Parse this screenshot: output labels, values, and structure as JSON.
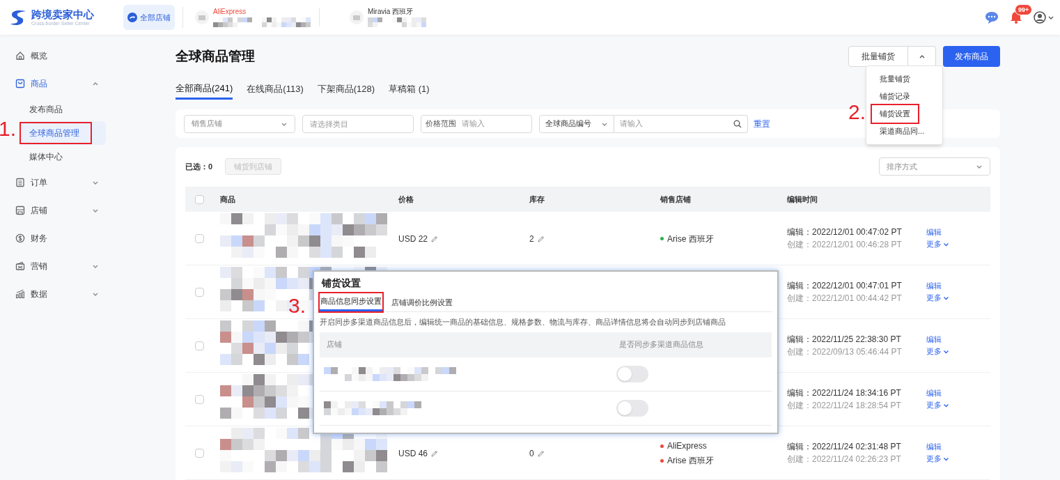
{
  "header": {
    "logo_title": "跨境卖家中心",
    "logo_subtitle": "Cross-border Seller Center",
    "store_tabs": [
      {
        "label": "全部店铺",
        "selected": true
      },
      {
        "label": "AliExpress",
        "selected": false,
        "color": "#f0483c"
      },
      {
        "label": "Miravia 西班牙",
        "selected": false
      }
    ],
    "notification_badge": "99+"
  },
  "sidebar": {
    "items": [
      {
        "label": "概览",
        "selected": false
      },
      {
        "label": "商品",
        "selected": true,
        "expanded": true,
        "children": [
          {
            "label": "发布商品",
            "selected": false,
            "highlighted": false
          },
          {
            "label": "全球商品管理",
            "selected": true,
            "highlighted": true
          },
          {
            "label": "媒体中心",
            "selected": false,
            "highlighted": false
          }
        ]
      },
      {
        "label": "订单",
        "selected": false,
        "expanded": false
      },
      {
        "label": "店铺",
        "selected": false,
        "expanded": false
      },
      {
        "label": "财务",
        "selected": false
      },
      {
        "label": "营销",
        "selected": false,
        "expanded": false
      },
      {
        "label": "数据",
        "selected": false,
        "expanded": false
      }
    ]
  },
  "page_title": "全球商品管理",
  "actions": {
    "bulk_button": "批量铺货",
    "bulk_menu_expanded": true,
    "publish_button": "发布商品",
    "bulk_menu": [
      {
        "label": "批量铺货",
        "highlighted": false
      },
      {
        "label": "铺货记录",
        "highlighted": false
      },
      {
        "label": "铺货设置",
        "highlighted": true
      },
      {
        "label": "渠道商品同...",
        "highlighted": false
      }
    ]
  },
  "tabs": [
    {
      "label": "全部商品(241)",
      "selected": true
    },
    {
      "label": "在线商品(113)",
      "selected": false
    },
    {
      "label": "下架商品(128)",
      "selected": false
    },
    {
      "label": "草稿箱 (1)",
      "selected": false
    }
  ],
  "filters": {
    "store_select": "销售店铺",
    "category_placeholder": "请选择类目",
    "price_label": "价格范围",
    "price_placeholder": "请输入",
    "code_select": "全球商品编号",
    "code_placeholder": "请输入",
    "reset": "重置"
  },
  "toolbar": {
    "selected_count": "已选：0",
    "distribute_button": "铺货到店铺",
    "distribute_disabled": true,
    "sort_select": "排序方式"
  },
  "table": {
    "all_checked": false,
    "columns": [
      "商品",
      "价格",
      "库存",
      "销售店铺",
      "编辑时间"
    ],
    "rows": [
      {
        "checked": false,
        "price": "USD 22",
        "stock": "2",
        "stores": [
          {
            "name": "Arise 西班牙",
            "color": "#2bb24c"
          }
        ],
        "edited": "编辑：2022/12/01 00:47:02 PT",
        "created": "创建：2022/12/01 00:46:28 PT",
        "edit": "编辑",
        "more": "更多"
      },
      {
        "checked": false,
        "edited": "编辑：2022/12/01 00:47:01 PT",
        "created": "创建：2022/12/01 00:44:42 PT",
        "edit": "编辑",
        "more": "更多"
      },
      {
        "checked": false,
        "edited": "编辑：2022/11/25 22:38:30 PT",
        "created": "创建：2022/09/13 05:46:44 PT",
        "edit": "编辑",
        "more": "更多"
      },
      {
        "checked": false,
        "edited": "编辑：2022/11/24 18:34:16 PT",
        "created": "创建：2022/11/24 18:28:54 PT",
        "edit": "编辑",
        "more": "更多"
      },
      {
        "checked": false,
        "price": "USD 46",
        "stock": "0",
        "stores": [
          {
            "name": "AliExpress",
            "color": "#f0483c"
          },
          {
            "name": "Arise 西班牙",
            "color": "#f0483c"
          }
        ],
        "edited": "编辑：2022/11/24 02:31:48 PT",
        "created": "创建：2022/11/24 02:26:23 PT",
        "edit": "编辑",
        "more": "更多"
      }
    ]
  },
  "dialog": {
    "title": "铺货设置",
    "tabs": [
      {
        "label": "商品信息同步设置",
        "selected": true,
        "highlighted": true
      },
      {
        "label": "店铺调价比例设置",
        "selected": false,
        "highlighted": false
      }
    ],
    "description": "开启同步多渠道商品信息后，编辑统一商品的基础信息、规格参数、物流与库存、商品详情信息将会自动同步到店铺商品",
    "columns": [
      "店铺",
      "是否同步多渠道商品信息"
    ],
    "rows": [
      {
        "on": false
      },
      {
        "on": false
      }
    ]
  },
  "annotations": [
    {
      "label": "1."
    },
    {
      "label": "2."
    },
    {
      "label": "3."
    }
  ]
}
